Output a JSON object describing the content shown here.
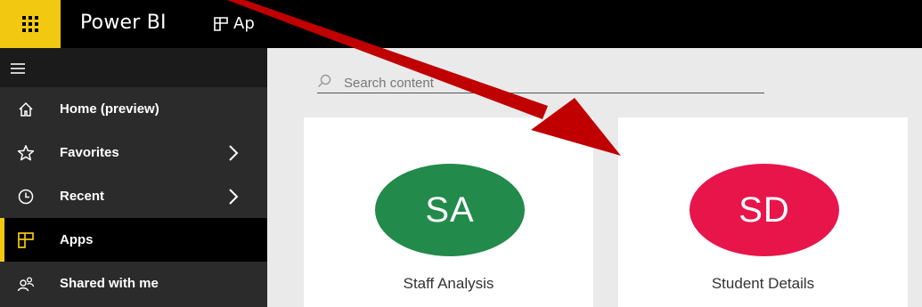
{
  "app": {
    "title": "Power BI",
    "breadcrumb": "Apps",
    "breadcrumb_partial": "Ap"
  },
  "colors": {
    "accent": "#f2c811",
    "nav_bg": "#2b2b2b",
    "topbar": "#000000",
    "arrow": "#c00000"
  },
  "nav": {
    "items": [
      {
        "label": "Home (preview)",
        "icon": "home-icon"
      },
      {
        "label": "Favorites",
        "icon": "star-icon",
        "expandable": true
      },
      {
        "label": "Recent",
        "icon": "clock-icon",
        "expandable": true
      },
      {
        "label": "Apps",
        "icon": "apps-icon",
        "active": true
      },
      {
        "label": "Shared with me",
        "icon": "shared-icon"
      }
    ]
  },
  "search": {
    "placeholder": "Search content"
  },
  "apps": [
    {
      "initials": "SA",
      "name": "Staff Analysis",
      "color": "#228a4a"
    },
    {
      "initials": "SD",
      "name": "Student Details",
      "color": "#e8154a"
    }
  ]
}
